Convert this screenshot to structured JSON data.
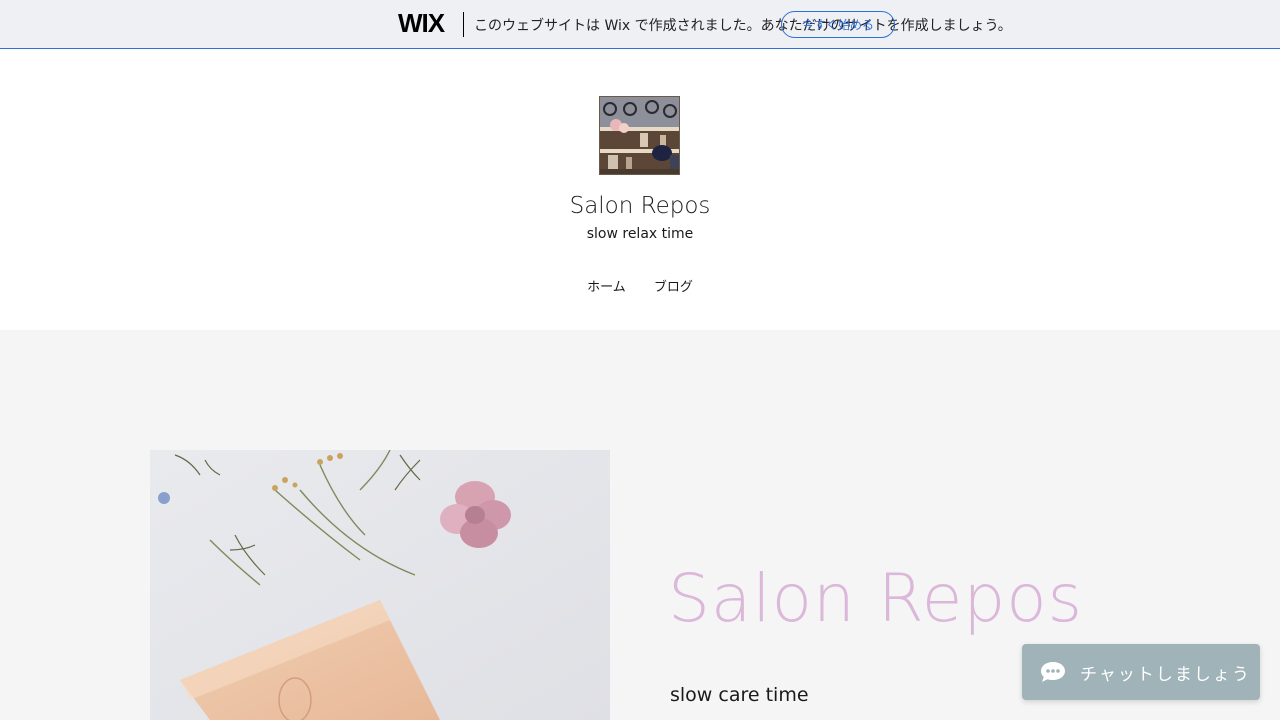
{
  "wix_banner": {
    "logo": "WIX",
    "message": "このウェブサイトは Wix で作成されました。あなただけのサイトを作成しましょう。",
    "cta_label": "今すぐ始める"
  },
  "header": {
    "site_title": "Salon Repos",
    "tagline": "slow relax time",
    "nav": [
      {
        "label": "ホーム"
      },
      {
        "label": "ブログ"
      }
    ]
  },
  "hero": {
    "title": "Salon Repos",
    "subtitle": "slow care time"
  },
  "chat": {
    "label": "チャットしましょう",
    "icon": "chat-bubble-icon"
  },
  "colors": {
    "wix_accent": "#2f6fd6",
    "hero_title": "#dbb8d9",
    "hero_bg": "#f5f5f6",
    "chat_bg": "#9fb3b8"
  }
}
